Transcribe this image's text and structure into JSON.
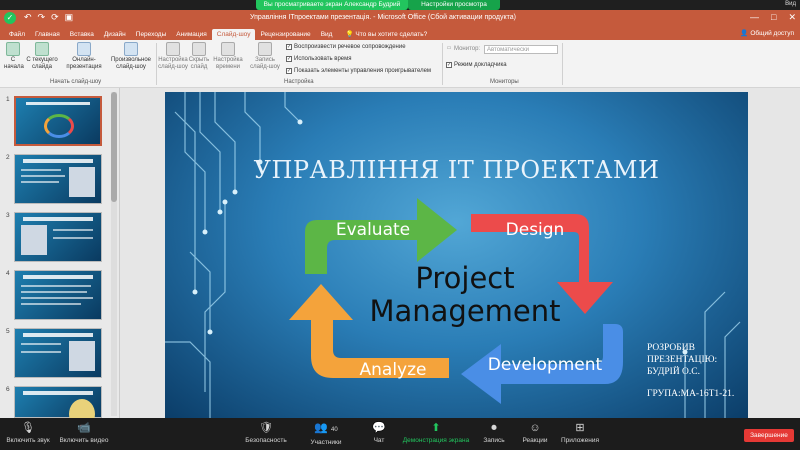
{
  "zoom_top": {
    "notice": "Вы просматриваете экран Александр Будрий",
    "options": "Настройки просмотра",
    "right": "Вид"
  },
  "window": {
    "title": "Управління ІТпроектами презентація. - Microsoft Office (Сбой активации продукта)",
    "controls": [
      "—",
      "□",
      "✕"
    ],
    "quick_access": [
      "↶",
      "↷",
      "⟳",
      "▣"
    ]
  },
  "ribbon_tabs": [
    "Файл",
    "Главная",
    "Вставка",
    "Дизайн",
    "Переходы",
    "Анимация",
    "Слайд-шоу",
    "Рецензирование",
    "Вид"
  ],
  "active_tab": "Слайд-шоу",
  "tell_me": "Что вы хотите сделать?",
  "share": "Общий доступ",
  "ribbon": {
    "buttons": [
      {
        "label": "С начала"
      },
      {
        "label": "С текущего слайда"
      },
      {
        "label": "Онлайн-презентация"
      },
      {
        "label": "Произвольное слайд-шоу"
      },
      {
        "label": "Настройка слайд-шоу"
      },
      {
        "label": "Скрыть слайд"
      },
      {
        "label": "Настройка времени"
      },
      {
        "label": "Запись слайд-шоу"
      }
    ],
    "checks": [
      {
        "label": "Воспроизвести речевое сопровождение",
        "checked": true
      },
      {
        "label": "Использовать время",
        "checked": true
      },
      {
        "label": "Показать элементы управления проигрывателем",
        "checked": true
      }
    ],
    "monitor_label": "Монитор:",
    "monitor_value": "Автоматически",
    "presenter_label": "Режим докладчика",
    "groups": [
      "Начать слайд-шоу",
      "Настройка",
      "Мониторы"
    ]
  },
  "thumbnails": [
    "1",
    "2",
    "3",
    "4",
    "5",
    "6"
  ],
  "slide": {
    "title": "УПРАВЛІННЯ ІТ ПРОЕКТАМИ",
    "diagram": {
      "steps": [
        "Evaluate",
        "Design",
        "Development",
        "Analyze"
      ],
      "center_line1": "Project",
      "center_line2": "Management",
      "colors": [
        "#5cb646",
        "#ec4b4b",
        "#4a8ee6",
        "#f4a33b"
      ]
    },
    "author_lines": [
      "РОЗРОБИВ",
      "ПРЕЗЕНТАЦІЮ:",
      "БУДРІЙ О.С."
    ],
    "group": "ГРУПА:МА-16Т1-21."
  },
  "bottom_bar": {
    "items": [
      {
        "label": "Включить звук",
        "icon": "mic-off-icon"
      },
      {
        "label": "Включить видео",
        "icon": "video-off-icon"
      },
      {
        "label": "Безопасность",
        "icon": "shield-icon"
      },
      {
        "label": "Участники",
        "icon": "participants-icon",
        "count": "40"
      },
      {
        "label": "Чат",
        "icon": "chat-icon"
      },
      {
        "label": "Демонстрация экрана",
        "icon": "share-screen-icon"
      },
      {
        "label": "Запись",
        "icon": "record-icon"
      },
      {
        "label": "Реакции",
        "icon": "reaction-icon"
      },
      {
        "label": "Приложения",
        "icon": "apps-icon"
      }
    ],
    "end": "Завершение"
  }
}
